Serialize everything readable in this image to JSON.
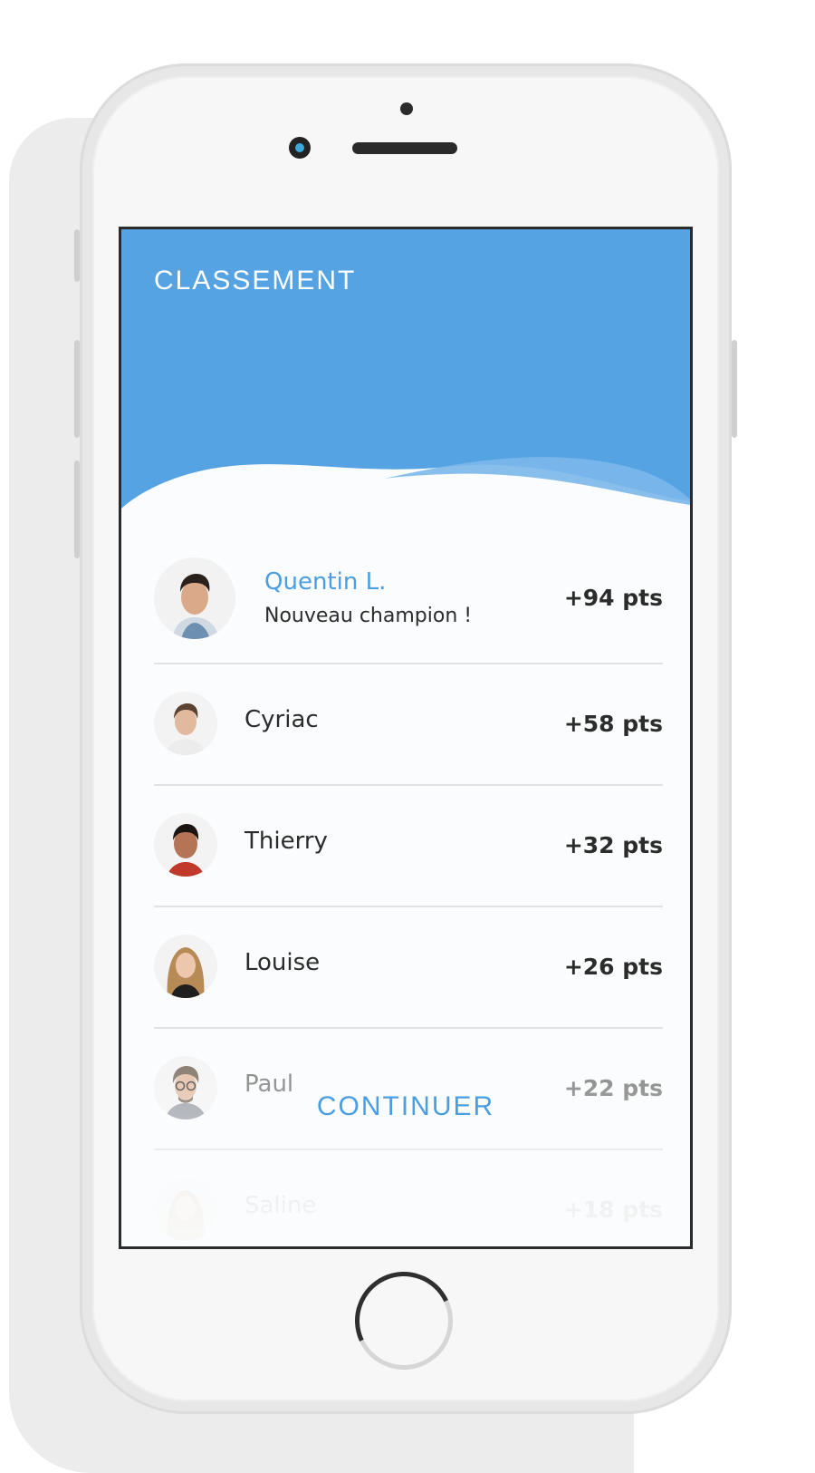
{
  "header": {
    "title": "CLASSEMENT"
  },
  "leaderboard": [
    {
      "name": "Quentin L.",
      "subtitle": "Nouveau champion !",
      "points": "+94 pts",
      "avatar": "avatar-quentin"
    },
    {
      "name": "Cyriac",
      "points": "+58 pts",
      "avatar": "avatar-cyriac"
    },
    {
      "name": "Thierry",
      "points": "+32 pts",
      "avatar": "avatar-thierry"
    },
    {
      "name": "Louise",
      "points": "+26 pts",
      "avatar": "avatar-louise"
    },
    {
      "name": "Paul",
      "points": "+22 pts",
      "avatar": "avatar-paul"
    },
    {
      "name": "Saline",
      "points": "+18 pts",
      "avatar": "avatar-saline"
    }
  ],
  "footer": {
    "continue_label": "CONTINUER"
  },
  "colors": {
    "header_blue": "#56a3e3",
    "header_wave_light": "#7bb7ea",
    "accent_blue": "#4a9ee2",
    "text_dark": "#2c2c2c",
    "divider": "#dfe3e8"
  }
}
